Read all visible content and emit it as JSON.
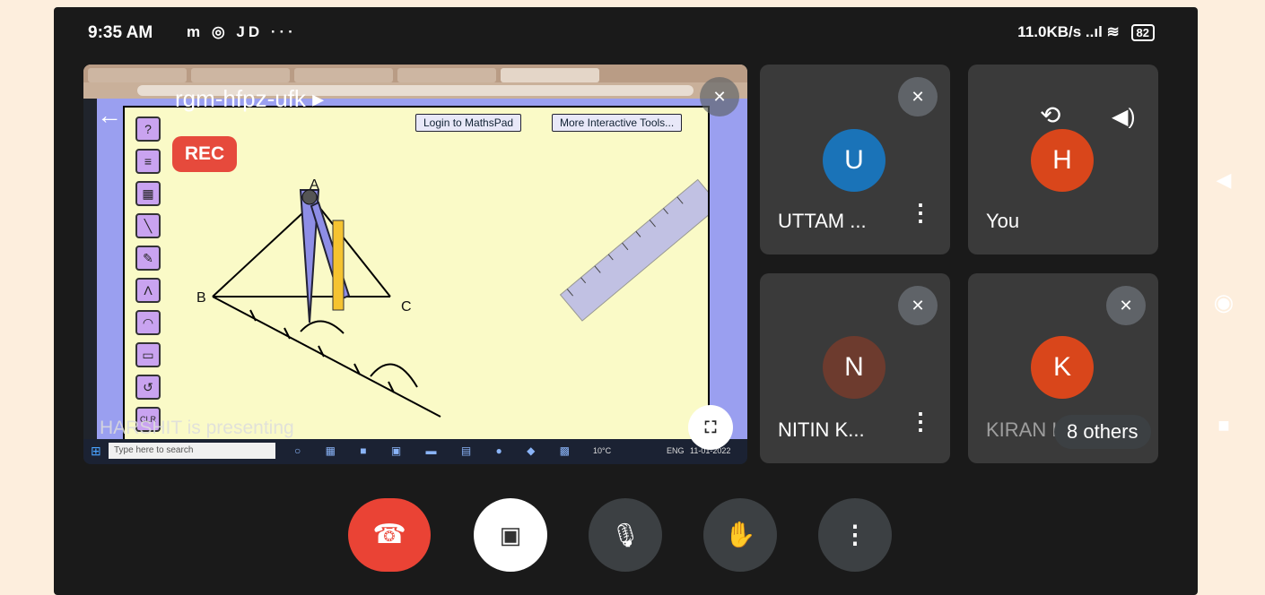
{
  "status_bar": {
    "time": "9:35 AM",
    "notif_icons": "m ◎ JD ···",
    "network_speed": "11.0KB/s",
    "battery": "82"
  },
  "presentation": {
    "meeting_code": "rgm-hfpz-ufk",
    "rec_label": "REC",
    "presenter_text": "HARSHIT is presenting",
    "mathspad": {
      "login_button": "Login to MathsPad",
      "tools_button": "More Interactive Tools...",
      "clr_label": "CLR",
      "taskbar_search": "Type here to search",
      "taskbar_temp": "10°C",
      "taskbar_lang": "ENG",
      "taskbar_date": "11-01-2022",
      "point_labels": [
        "A",
        "B",
        "C"
      ]
    }
  },
  "participants": [
    {
      "initial": "U",
      "name": "UTTAM ...",
      "color": "#1a73b8",
      "muted": true
    },
    {
      "initial": "H",
      "name": "You",
      "color": "#d9461b",
      "muted": false
    },
    {
      "initial": "N",
      "name": "NITIN K...",
      "color": "#6d3b2e",
      "muted": true
    },
    {
      "initial": "K",
      "name": "KIRAN KUMAR",
      "color": "#d9461b",
      "muted": true
    }
  ],
  "others_pill": "8 others",
  "controls": {
    "end_call_color": "#ea4335",
    "video_off_color": "#ffffff",
    "button_color": "#3c4043"
  }
}
